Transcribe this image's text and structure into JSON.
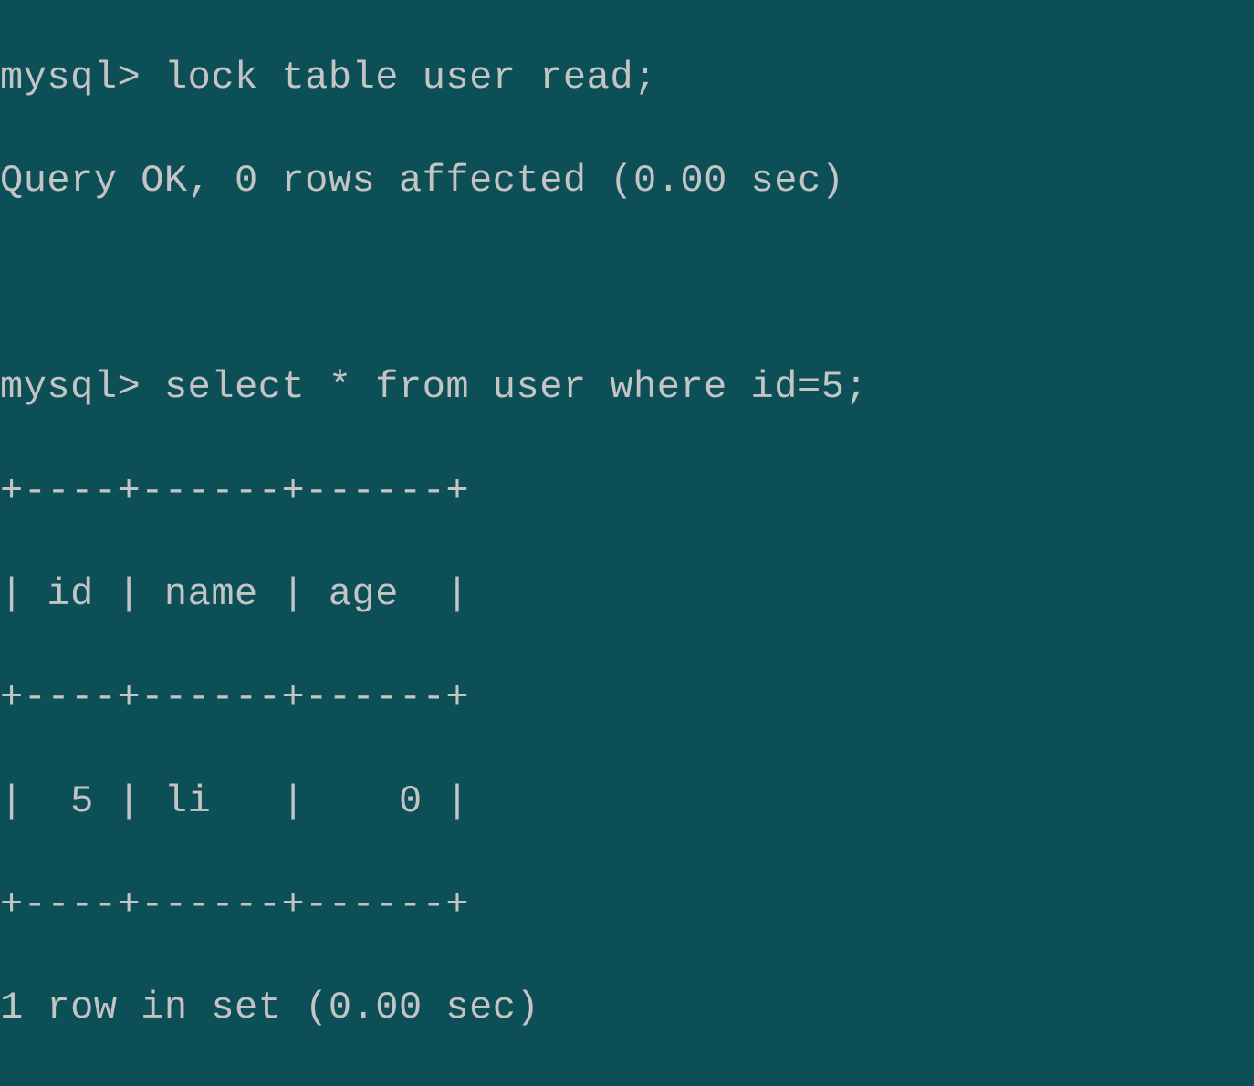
{
  "terminal": {
    "prompt": "mysql>",
    "command1": "lock table user read;",
    "response1": "Query OK, 0 rows affected (0.00 sec)",
    "command2": "select * from user where id=5;",
    "table": {
      "border_top": "+----+------+------+",
      "header": "| id | name | age  |",
      "border_mid": "+----+------+------+",
      "row1": "|  5 | li   |    0 |",
      "border_bot": "+----+------+------+"
    },
    "response2": "1 row in set (0.00 sec)"
  }
}
